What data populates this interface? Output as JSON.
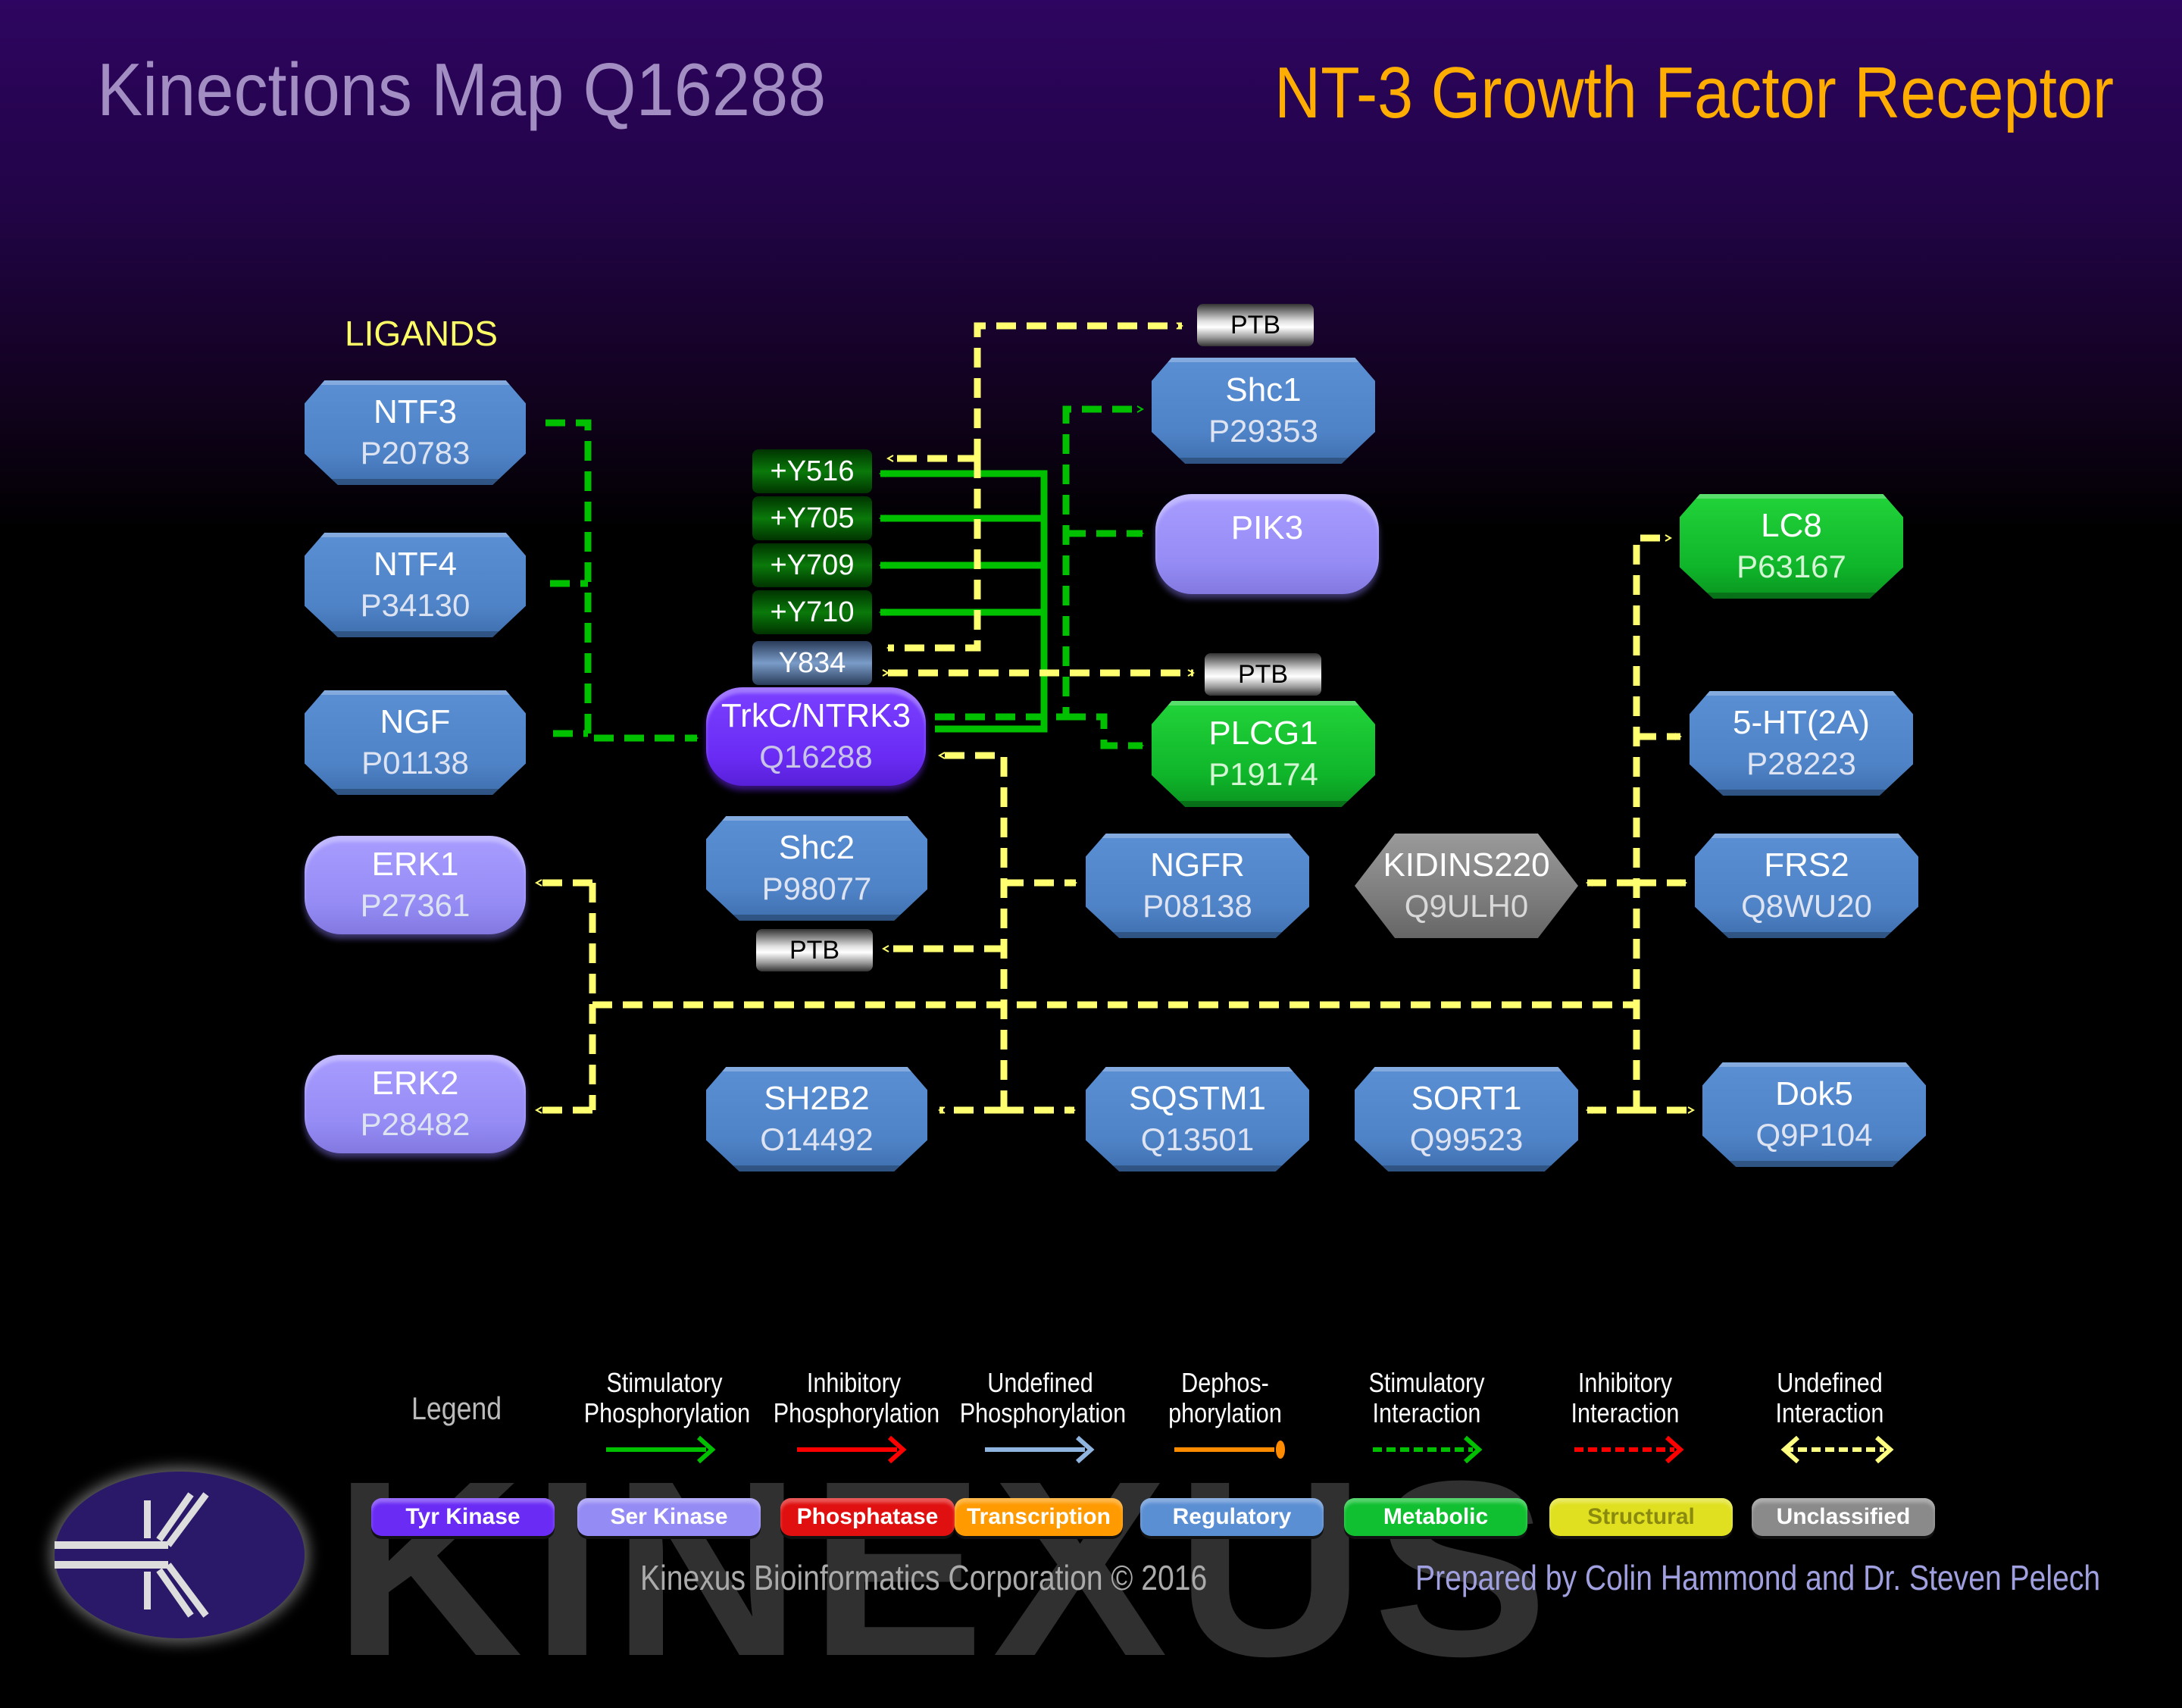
{
  "header": {
    "title": "Kinections Map Q16288",
    "subtitle": "NT-3 Growth Factor Receptor"
  },
  "section_label": "LIGANDS",
  "nodes": {
    "ntf3": {
      "name": "NTF3",
      "id": "P20783",
      "type": "Regulatory"
    },
    "ntf4": {
      "name": "NTF4",
      "id": "P34130",
      "type": "Regulatory"
    },
    "ngf": {
      "name": "NGF",
      "id": "P01138",
      "type": "Regulatory"
    },
    "trkc": {
      "name": "TrkC/NTRK3",
      "id": "Q16288",
      "type": "Tyr Kinase"
    },
    "erk1": {
      "name": "ERK1",
      "id": "P27361",
      "type": "Ser Kinase"
    },
    "erk2": {
      "name": "ERK2",
      "id": "P28482",
      "type": "Ser Kinase"
    },
    "shc2": {
      "name": "Shc2",
      "id": "P98077",
      "type": "Regulatory"
    },
    "sh2b2": {
      "name": "SH2B2",
      "id": "O14492",
      "type": "Regulatory"
    },
    "shc1": {
      "name": "Shc1",
      "id": "P29353",
      "type": "Regulatory"
    },
    "pik3": {
      "name": "PIK3",
      "id": "",
      "type": "Ser Kinase"
    },
    "plcg1": {
      "name": "PLCG1",
      "id": "P19174",
      "type": "Metabolic"
    },
    "ngfr": {
      "name": "NGFR",
      "id": "P08138",
      "type": "Regulatory"
    },
    "sqstm1": {
      "name": "SQSTM1",
      "id": "Q13501",
      "type": "Regulatory"
    },
    "kidins220": {
      "name": "KIDINS220",
      "id": "Q9ULH0",
      "type": "Unclassified"
    },
    "sort1": {
      "name": "SORT1",
      "id": "Q99523",
      "type": "Regulatory"
    },
    "lc8": {
      "name": "LC8",
      "id": "P63167",
      "type": "Metabolic"
    },
    "5ht2a": {
      "name": "5-HT(2A)",
      "id": "P28223",
      "type": "Regulatory"
    },
    "frs2": {
      "name": "FRS2",
      "id": "Q8WU20",
      "type": "Regulatory"
    },
    "dok5": {
      "name": "Dok5",
      "id": "Q9P104",
      "type": "Regulatory"
    }
  },
  "sites": [
    {
      "label": "+Y516",
      "kind": "stimulatory"
    },
    {
      "label": "+Y705",
      "kind": "stimulatory"
    },
    {
      "label": "+Y709",
      "kind": "stimulatory"
    },
    {
      "label": "+Y710",
      "kind": "stimulatory"
    },
    {
      "label": "Y834",
      "kind": "undefined"
    }
  ],
  "domains": {
    "ptb_top": "PTB",
    "ptb_mid": "PTB",
    "ptb_shc2": "PTB"
  },
  "legend": {
    "title": "Legend",
    "arrows": [
      {
        "label": "Stimulatory Phosphorylation",
        "color": "#00c000"
      },
      {
        "label": "Inhibitory Phosphorylation",
        "color": "#ff0000"
      },
      {
        "label": "Undefined Phosphorylation",
        "color": "#8fb4e0"
      },
      {
        "label": "Dephos-phorylation",
        "color": "#ff8c00"
      },
      {
        "label": "Stimulatory Interaction",
        "color": "#00c000"
      },
      {
        "label": "Inhibitory Interaction",
        "color": "#ff0000"
      },
      {
        "label": "Undefined Interaction",
        "color": "#ffff80"
      }
    ],
    "types": [
      {
        "label": "Tyr Kinase",
        "color": "#6a2cf5"
      },
      {
        "label": "Ser Kinase",
        "color": "#958bf4"
      },
      {
        "label": "Phosphatase",
        "color": "#e01010"
      },
      {
        "label": "Transcription",
        "color": "#ff9a00"
      },
      {
        "label": "Regulatory",
        "color": "#5b8fd4"
      },
      {
        "label": "Metabolic",
        "color": "#10c030"
      },
      {
        "label": "Structural",
        "color": "#e0e020"
      },
      {
        "label": "Unclassified",
        "color": "#8a8a8a"
      }
    ]
  },
  "footer": {
    "copyright": "Kinexus Bioinformatics Corporation © 2016",
    "credits": "Prepared by Colin Hammond and Dr. Steven Pelech",
    "watermark": "KINEXUS"
  },
  "colors": {
    "stimulatory": "#00c000",
    "undefined_interaction": "#ffff70",
    "title_left": "#a28ec2",
    "title_right": "#ffad00"
  }
}
